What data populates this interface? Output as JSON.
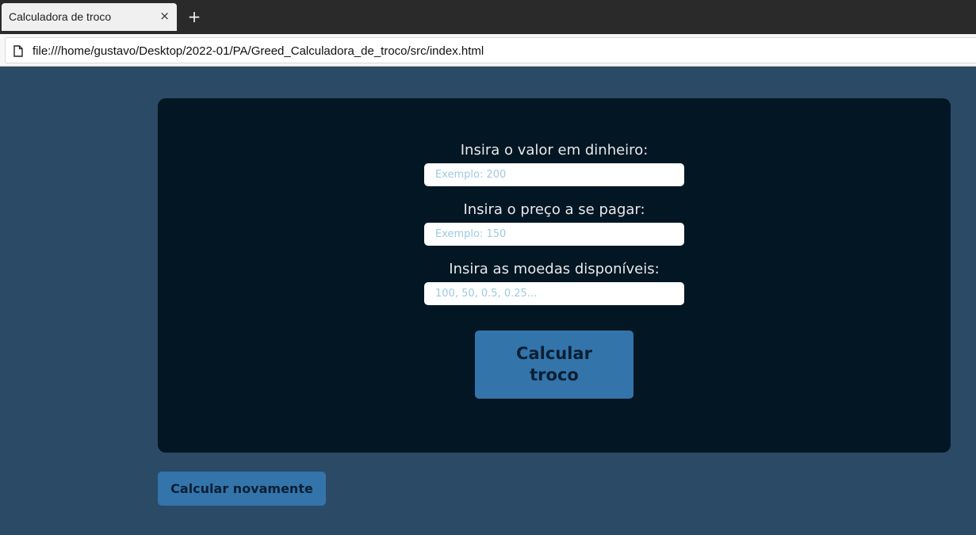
{
  "browser": {
    "tab_title": "Calculadora de troco",
    "tab_close": "×",
    "new_tab": "+",
    "url": "file:///home/gustavo/Desktop/2022-01/PA/Greed_Calculadora_de_troco/src/index.html"
  },
  "form": {
    "money_label": "Insira o valor em dinheiro:",
    "money_placeholder": "Exemplo: 200",
    "price_label": "Insira o preço a se pagar:",
    "price_placeholder": "Exemplo: 150",
    "coins_label": "Insira as moedas disponíveis:",
    "coins_placeholder": "100, 50, 0.5, 0.25...",
    "calculate_label": "Calcular troco"
  },
  "actions": {
    "again_label": "Calcular novamente"
  },
  "colors": {
    "page_bg": "#2b4a66",
    "card_bg": "#021624",
    "button_bg": "#3374ab"
  }
}
